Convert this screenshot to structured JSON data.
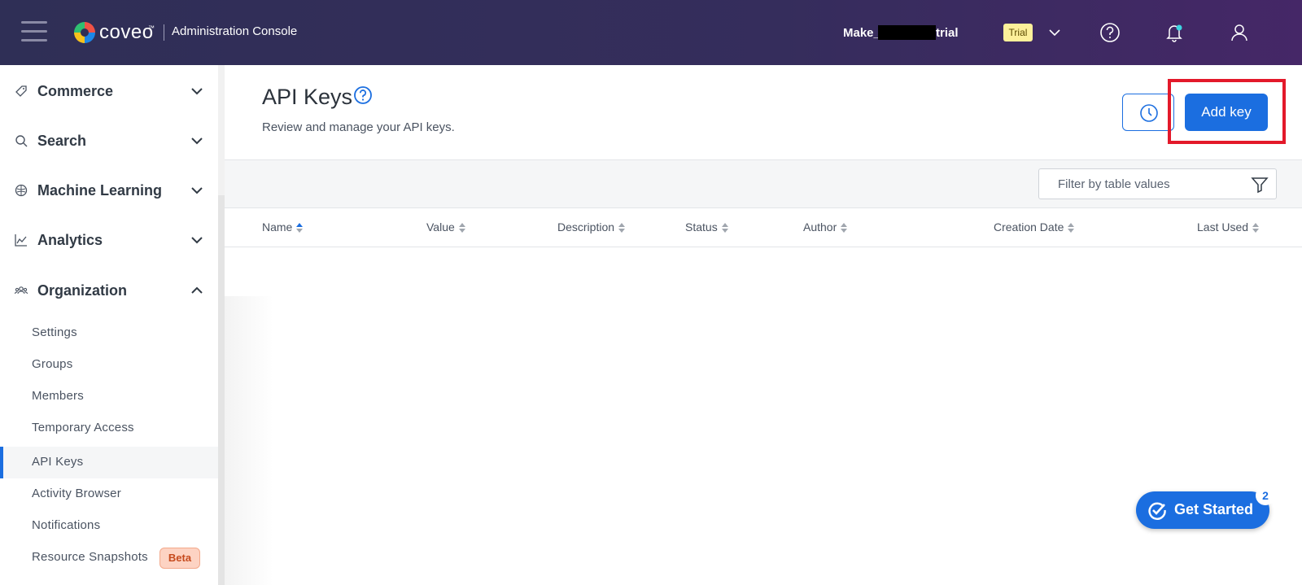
{
  "topbar": {
    "brand": "coveo",
    "brand_tm": "™",
    "console_title": "Administration Console",
    "org_name_prefix": "Make_",
    "org_name_suffix": "trial",
    "trial_badge": "Trial"
  },
  "sidebar": {
    "sections": [
      {
        "label": "Commerce",
        "icon": "tag-icon",
        "expanded": false
      },
      {
        "label": "Search",
        "icon": "search-icon",
        "expanded": false
      },
      {
        "label": "Machine Learning",
        "icon": "brain-icon",
        "expanded": false
      },
      {
        "label": "Analytics",
        "icon": "chart-line-icon",
        "expanded": false
      },
      {
        "label": "Organization",
        "icon": "people-icon",
        "expanded": true
      }
    ],
    "items": [
      {
        "label": "Settings"
      },
      {
        "label": "Groups"
      },
      {
        "label": "Members"
      },
      {
        "label": "Temporary Access"
      },
      {
        "label": "API Keys",
        "active": true
      },
      {
        "label": "Activity Browser"
      },
      {
        "label": "Notifications"
      },
      {
        "label": "Resource Snapshots",
        "badge": "Beta"
      }
    ]
  },
  "main": {
    "title": "API Keys",
    "description": "Review and manage your API keys.",
    "add_button": "Add key",
    "filter_placeholder": "Filter by table values",
    "columns": [
      "Name",
      "Value",
      "Description",
      "Status",
      "Author",
      "Creation Date",
      "Last Used"
    ],
    "sorted_column": "Name"
  },
  "get_started": {
    "label": "Get Started",
    "count": "2"
  },
  "colors": {
    "primary": "#1b6ee0",
    "highlight": "#e3192a",
    "topbar": "#2f2f56"
  }
}
